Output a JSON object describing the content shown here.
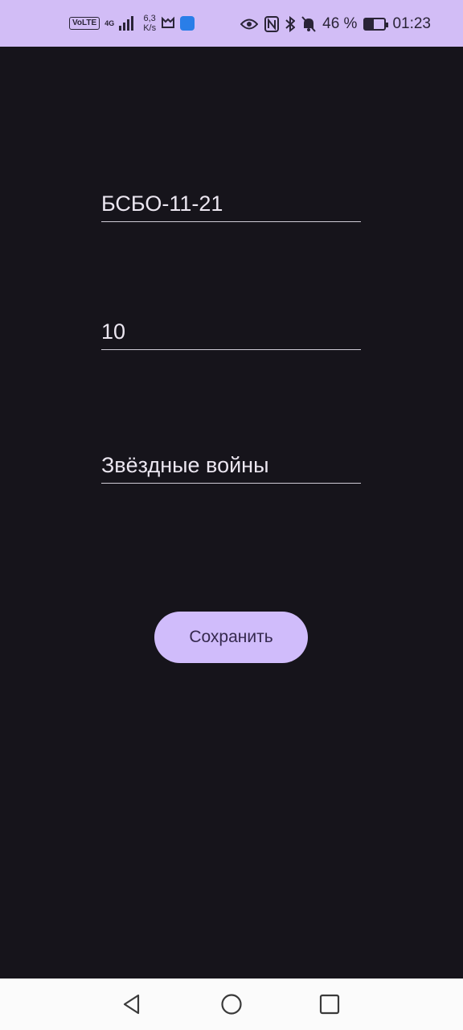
{
  "status_bar": {
    "volte": "VoLTE",
    "network_type": "4G",
    "data_speed": "6,3",
    "data_speed_unit": "K/s",
    "battery_percent": "46 %",
    "battery_level": 0.46,
    "time": "01:23",
    "icons": [
      "volte-icon",
      "signal-icon",
      "notification-app-icon",
      "shield-icon",
      "eye-icon",
      "nfc-icon",
      "bluetooth-icon",
      "mute-icon",
      "battery-icon"
    ]
  },
  "form": {
    "group_value": "БСБО-11-21",
    "number_value": "10",
    "movie_value": "Звёздные войны",
    "save_label": "Сохранить"
  },
  "nav_bar": {
    "icons": [
      "back-icon",
      "home-icon",
      "recents-icon"
    ]
  },
  "colors": {
    "background": "#16141b",
    "status_bar": "#d2bdf6",
    "button": "#d0bcfb",
    "button_text": "#35294e",
    "text": "#ebe6f0"
  }
}
